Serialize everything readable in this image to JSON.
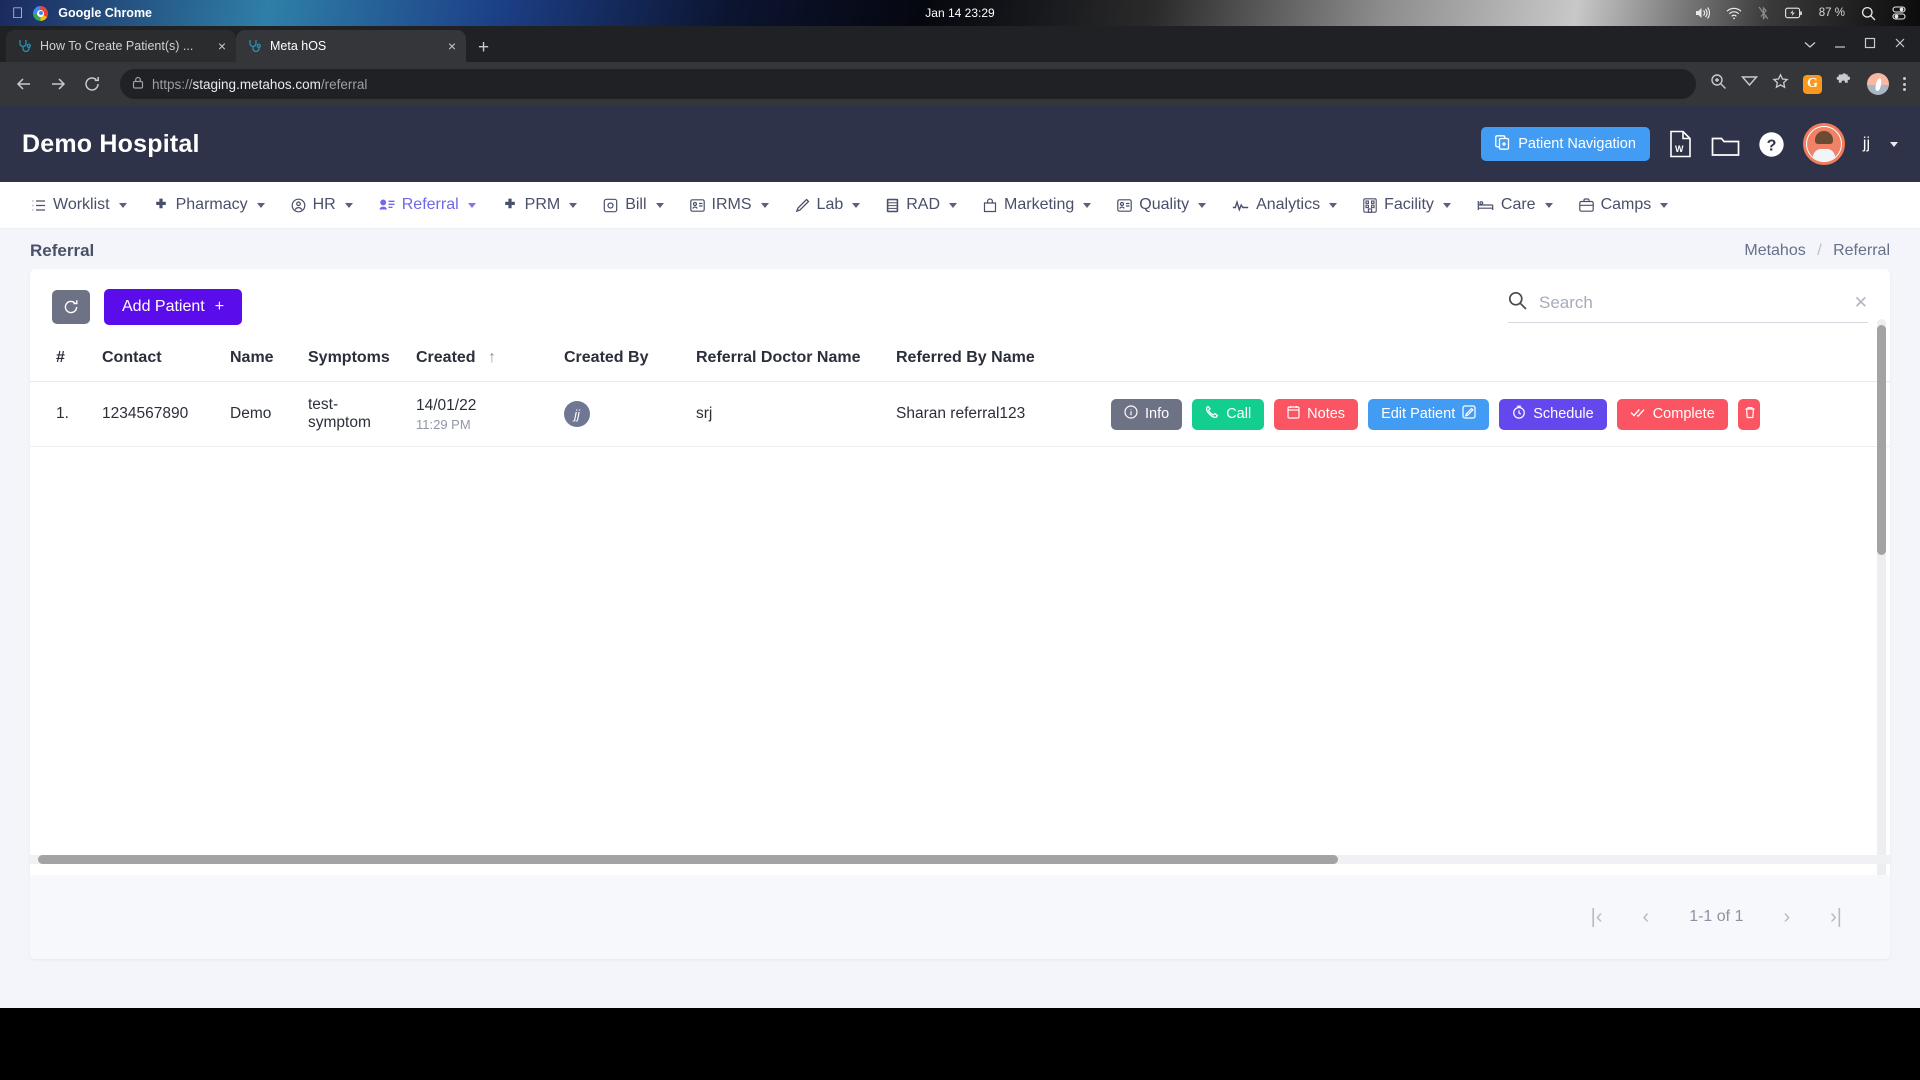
{
  "os_bar": {
    "apple_logo": "",
    "app_name": "Google Chrome",
    "clock": "Jan 14  23:29",
    "battery_pct": "87 %"
  },
  "browser": {
    "tabs": [
      {
        "title": "How To Create Patient(s) ...",
        "close": "×",
        "active": false
      },
      {
        "title": "Meta hOS",
        "close": "×",
        "active": true
      }
    ],
    "new_tab": "+",
    "nav": {
      "back": "←",
      "forward": "→",
      "reload": "⟳"
    },
    "url_scheme": "https://",
    "url_host": "staging.metahos.com",
    "url_path": "/referral",
    "toolbar_icons": [
      "zoom-icon",
      "send-icon",
      "star-icon",
      "g-extension-icon",
      "puzzle-icon",
      "profile-avatar",
      "kebab-menu"
    ],
    "ext_g_label": "G"
  },
  "header": {
    "brand": "Demo Hospital",
    "patient_nav_label": "Patient Navigation",
    "icons": [
      "word-doc-icon",
      "folder-icon",
      "help-icon"
    ],
    "user_name": "jj"
  },
  "modnav": {
    "items": [
      {
        "label": "Worklist",
        "icon": "list-icon",
        "active": false
      },
      {
        "label": "Pharmacy",
        "icon": "plus-icon",
        "active": false
      },
      {
        "label": "HR",
        "icon": "user-circle-icon",
        "active": false
      },
      {
        "label": "Referral",
        "icon": "user-list-icon",
        "active": true
      },
      {
        "label": "PRM",
        "icon": "plus-icon",
        "active": false
      },
      {
        "label": "Bill",
        "icon": "receipt-icon",
        "active": false
      },
      {
        "label": "IRMS",
        "icon": "id-card-icon",
        "active": false
      },
      {
        "label": "Lab",
        "icon": "pen-icon",
        "active": false
      },
      {
        "label": "RAD",
        "icon": "film-icon",
        "active": false
      },
      {
        "label": "Marketing",
        "icon": "bag-icon",
        "active": false
      },
      {
        "label": "Quality",
        "icon": "id-card-icon",
        "active": false
      },
      {
        "label": "Analytics",
        "icon": "pulse-icon",
        "active": false
      },
      {
        "label": "Facility",
        "icon": "building-icon",
        "active": false
      },
      {
        "label": "Care",
        "icon": "bed-icon",
        "active": false
      },
      {
        "label": "Camps",
        "icon": "briefcase-icon",
        "active": false
      }
    ]
  },
  "page": {
    "title": "Referral",
    "breadcrumb": {
      "root": "Metahos",
      "separator": "/",
      "current": "Referral"
    }
  },
  "toolbar": {
    "refresh_label": "⟳",
    "add_patient_label": "Add Patient",
    "add_patient_plus": "+"
  },
  "search": {
    "placeholder": "Search",
    "value": "",
    "clear_label": "✕"
  },
  "table": {
    "columns": [
      {
        "key": "idx",
        "label": "#"
      },
      {
        "key": "contact",
        "label": "Contact"
      },
      {
        "key": "name",
        "label": "Name"
      },
      {
        "key": "symptoms",
        "label": "Symptoms"
      },
      {
        "key": "created",
        "label": "Created",
        "sort": "asc",
        "sort_glyph": "↑"
      },
      {
        "key": "createdby",
        "label": "Created By"
      },
      {
        "key": "refdoc",
        "label": "Referral Doctor Name"
      },
      {
        "key": "refby",
        "label": "Referred By Name"
      }
    ],
    "rows": [
      {
        "idx": "1.",
        "contact": "1234567890",
        "name": "Demo",
        "symptoms": "test-symptom",
        "created_date": "14/01/22",
        "created_time": "11:29 PM",
        "created_by_initials": "jj",
        "referral_doctor": "srj",
        "referred_by": "Sharan referral123",
        "actions": [
          {
            "label": "Info",
            "style": "info",
            "icon": "info-icon"
          },
          {
            "label": "Call",
            "style": "call",
            "icon": "phone-icon"
          },
          {
            "label": "Notes",
            "style": "notes",
            "icon": "note-icon"
          },
          {
            "label": "Edit Patient",
            "style": "edit",
            "icon": "pencil-square-icon"
          },
          {
            "label": "Schedule",
            "style": "schedule",
            "icon": "clock-icon"
          },
          {
            "label": "Complete",
            "style": "complete",
            "icon": "double-check-icon"
          },
          {
            "label": "",
            "style": "cut",
            "icon": "trash-icon"
          }
        ]
      }
    ]
  },
  "pagination": {
    "first": "|‹",
    "prev": "‹",
    "label": "1-1 of 1",
    "next": "›",
    "last": "›|"
  },
  "colors": {
    "header_bg": "#2f3349",
    "accent_blue": "#439cf3",
    "accent_purple": "#5b0ceb",
    "nav_active": "#6f68e8",
    "green": "#13cf8f",
    "red": "#fb5462",
    "schedule_purple": "#6448ee",
    "page_bg": "#f4f5fa"
  }
}
